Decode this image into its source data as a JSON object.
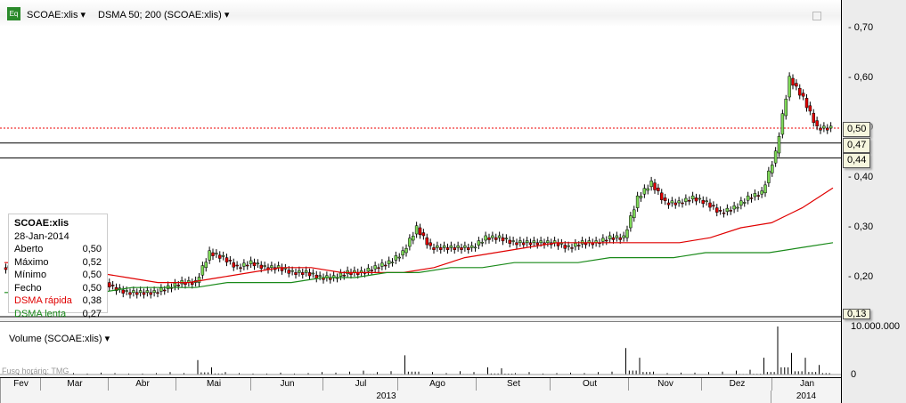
{
  "header": {
    "symbol": "SCOAE:xlis",
    "indicator": "DSMA 50; 200 (SCOAE:xlis)",
    "eq_icon": "Eq"
  },
  "legend": {
    "title": "SCOAE:xlis",
    "date": "28-Jan-2014",
    "rows": [
      {
        "label": "Aberto",
        "value": "0,50"
      },
      {
        "label": "Máximo",
        "value": "0,52"
      },
      {
        "label": "Mínimo",
        "value": "0,50"
      },
      {
        "label": "Fecho",
        "value": "0,50"
      },
      {
        "label": "DSMA rápida",
        "value": "0,38"
      },
      {
        "label": "DSMA lenta",
        "value": "0,27"
      }
    ]
  },
  "volume_panel": {
    "title": "Volume (SCOAE:xlis)",
    "timezone": "Fuso horário: TMG",
    "axis_max": "10.000.000",
    "axis_zero": "0"
  },
  "price_tags": [
    "0,50",
    "0,47",
    "0,44",
    "0,13"
  ],
  "colors": {
    "up": "#7ed957",
    "down": "#e00000",
    "fast": "#e00000",
    "slow": "#1a8a1a"
  },
  "chart_data": {
    "type": "candlestick",
    "y_ticks": [
      "0,70",
      "0,60",
      "0,50",
      "0,40",
      "0,30",
      "0,20"
    ],
    "y_tick_values": [
      0.7,
      0.6,
      0.5,
      0.4,
      0.3,
      0.2
    ],
    "ylim": [
      0.13,
      0.75
    ],
    "months": [
      "Fev",
      "Mar",
      "Abr",
      "Mai",
      "Jun",
      "Jul",
      "Ago",
      "Set",
      "Out",
      "Nov",
      "Dez",
      "Jan"
    ],
    "years": [
      "2013",
      "2014"
    ],
    "weekly_close": [
      0.22,
      0.22,
      0.21,
      0.2,
      0.2,
      0.21,
      0.2,
      0.18,
      0.17,
      0.17,
      0.17,
      0.18,
      0.19,
      0.19,
      0.25,
      0.24,
      0.22,
      0.23,
      0.22,
      0.22,
      0.21,
      0.21,
      0.2,
      0.2,
      0.21,
      0.21,
      0.22,
      0.23,
      0.25,
      0.3,
      0.26,
      0.26,
      0.26,
      0.26,
      0.28,
      0.28,
      0.27,
      0.27,
      0.27,
      0.27,
      0.26,
      0.27,
      0.27,
      0.28,
      0.28,
      0.36,
      0.39,
      0.35,
      0.35,
      0.36,
      0.35,
      0.33,
      0.34,
      0.36,
      0.37,
      0.45,
      0.6,
      0.56,
      0.5,
      0.5
    ],
    "dsma_fast": [
      0.23,
      0.23,
      0.22,
      0.21,
      0.2,
      0.19,
      0.19,
      0.2,
      0.21,
      0.22,
      0.22,
      0.21,
      0.21,
      0.21,
      0.22,
      0.24,
      0.25,
      0.26,
      0.27,
      0.27,
      0.27,
      0.27,
      0.27,
      0.28,
      0.3,
      0.31,
      0.34,
      0.38
    ],
    "dsma_slow": [
      0.17,
      0.17,
      0.17,
      0.17,
      0.18,
      0.18,
      0.18,
      0.19,
      0.19,
      0.19,
      0.2,
      0.2,
      0.21,
      0.21,
      0.22,
      0.22,
      0.23,
      0.23,
      0.23,
      0.24,
      0.24,
      0.24,
      0.25,
      0.25,
      0.25,
      0.26,
      0.27
    ],
    "volume_millions": [
      0.1,
      0.2,
      0.3,
      0.2,
      0.1,
      0.3,
      0.2,
      0.4,
      0.3,
      0.2,
      0.2,
      0.3,
      0.5,
      0.3,
      3.0,
      1.5,
      0.5,
      0.3,
      0.2,
      0.2,
      0.4,
      0.2,
      0.3,
      0.5,
      0.4,
      0.6,
      0.8,
      0.5,
      0.7,
      4.0,
      0.6,
      0.5,
      0.3,
      0.7,
      0.5,
      1.5,
      1.3,
      0.3,
      0.5,
      0.2,
      0.3,
      0.4,
      0.3,
      0.5,
      0.6,
      5.5,
      3.5,
      0.6,
      0.3,
      0.4,
      0.4,
      0.5,
      0.6,
      0.8,
      1.0,
      3.5,
      10.0,
      4.5,
      3.5,
      2.0
    ]
  }
}
